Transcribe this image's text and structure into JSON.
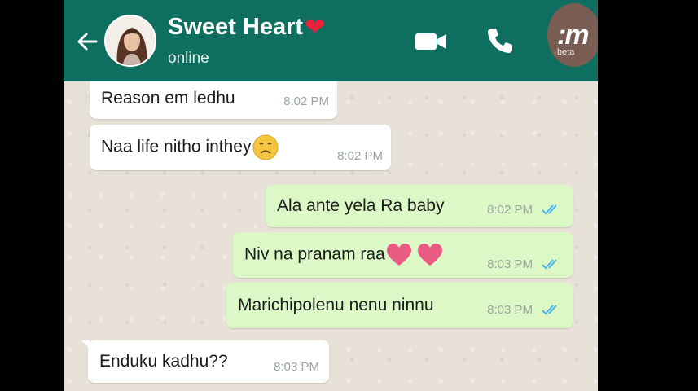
{
  "header": {
    "back_icon": "arrow-left-icon",
    "contact_name": "Sweet Heart",
    "name_emoji": "❤",
    "status": "online",
    "video_icon": "video-camera-icon",
    "call_icon": "phone-icon",
    "watermark_text": ":m",
    "watermark_small": "beta"
  },
  "colors": {
    "header_bg": "#0e6e5f",
    "incoming_bubble": "#ffffff",
    "outgoing_bubble": "#dcf8c6",
    "read_tick": "#4fb4e8",
    "chat_bg": "#e8e1d7"
  },
  "messages": [
    {
      "direction": "in",
      "text": "Reason em ledhu",
      "time": "8:02 PM"
    },
    {
      "direction": "in",
      "text": "Naa life nitho inthey",
      "emoji": "sad-face-icon",
      "time": "8:02 PM"
    },
    {
      "direction": "out",
      "text": "Ala ante yela Ra baby",
      "time": "8:02 PM",
      "status": "read"
    },
    {
      "direction": "out",
      "text": "Niv na pranam raa",
      "emoji": "pink-hearts-icon",
      "time": "8:03 PM",
      "status": "read"
    },
    {
      "direction": "out",
      "text": "Marichipolenu nenu ninnu",
      "time": "8:03 PM",
      "status": "read"
    },
    {
      "direction": "in",
      "text": "Enduku kadhu??",
      "time": "8:03 PM"
    }
  ]
}
